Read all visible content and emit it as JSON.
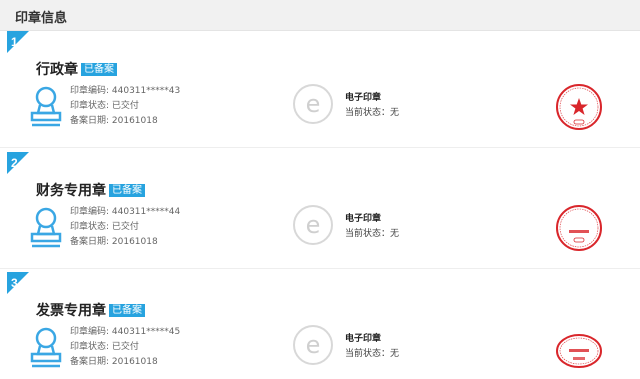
{
  "header": {
    "title": "印章信息"
  },
  "seals": [
    {
      "index": "1",
      "name": "行政章",
      "badge": "已备案",
      "code": "印章编码: 440311*****43",
      "status": "印章状态: 已交付",
      "date": "备案日期: 20161018",
      "e_title": "电子印章",
      "e_status": "当前状态：无",
      "seal_kind": "red-star-seal"
    },
    {
      "index": "2",
      "name": "财务专用章",
      "badge": "已备案",
      "code": "印章编码: 440311*****44",
      "status": "印章状态: 已交付",
      "date": "备案日期: 20161018",
      "e_title": "电子印章",
      "e_status": "当前状态：无",
      "seal_kind": "finance-seal"
    },
    {
      "index": "3",
      "name": "发票专用章",
      "badge": "已备案",
      "code": "印章编码: 440311*****45",
      "status": "印章状态: 已交付",
      "date": "备案日期: 20161018",
      "e_title": "电子印章",
      "e_status": "当前状态：无",
      "seal_kind": "invoice-seal"
    }
  ],
  "colors": {
    "accent": "#27a3df",
    "seal_red": "#d9262b",
    "icon_blue": "#3aa7e4",
    "e_gray": "#d8d8d8"
  }
}
